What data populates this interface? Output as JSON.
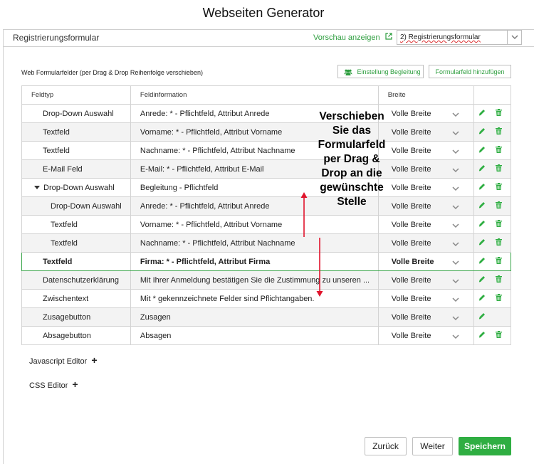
{
  "app_title": "Webseiten Generator",
  "topbar": {
    "section_label": "Registrierungsformular",
    "preview_label": "Vorschau anzeigen",
    "select_value": "2) Registrierungsformular"
  },
  "fields_label": "Web Formularfelder (per Drag & Drop Reihenfolge verschieben)",
  "buttons": {
    "accompaniment_settings": "Einstellung Begleitung",
    "add_field": "Formularfeld hinzufügen",
    "back": "Zurück",
    "next": "Weiter",
    "save": "Speichern"
  },
  "table": {
    "headers": [
      "Feldtyp",
      "Feldinformation",
      "Breite",
      ""
    ],
    "rows": [
      {
        "type": "Drop-Down Auswahl",
        "info": "Anrede: * - Pflichtfeld, Attribut Anrede",
        "width": "Volle Breite"
      },
      {
        "type": "Textfeld",
        "info": "Vorname: * - Pflichtfeld, Attribut Vorname",
        "width": "Volle Breite"
      },
      {
        "type": "Textfeld",
        "info": "Nachname: * - Pflichtfeld, Attribut Nachname",
        "width": "Volle Breite"
      },
      {
        "type": "E-Mail Feld",
        "info": "E-Mail: * - Pflichtfeld, Attribut E-Mail",
        "width": "Volle Breite"
      },
      {
        "type": "Drop-Down Auswahl",
        "info": "Begleitung - Pflichtfeld",
        "width": "Volle Breite"
      },
      {
        "type": "Drop-Down Auswahl",
        "info": "Anrede: * - Pflichtfeld, Attribut Anrede",
        "width": "Volle Breite"
      },
      {
        "type": "Textfeld",
        "info": "Vorname: * - Pflichtfeld, Attribut Vorname",
        "width": "Volle Breite"
      },
      {
        "type": "Textfeld",
        "info": "Nachname: * - Pflichtfeld, Attribut Nachname",
        "width": "Volle Breite"
      },
      {
        "type": "Textfeld",
        "info": "Firma: * - Pflichtfeld, Attribut Firma",
        "width": "Volle Breite"
      },
      {
        "type": "Datenschutzerklärung",
        "info": "Mit Ihrer Anmeldung bestätigen Sie die Zustimmung zu unseren ...",
        "width": "Volle Breite"
      },
      {
        "type": "Zwischentext",
        "info": "Mit * gekennzeichnete Felder sind Pflichtangaben.",
        "width": "Volle Breite"
      },
      {
        "type": "Zusagebutton",
        "info": "Zusagen",
        "width": "Volle Breite"
      },
      {
        "type": "Absagebutton",
        "info": "Absagen",
        "width": "Volle Breite"
      }
    ]
  },
  "overlay_text": "Verschieben Sie das Formularfeld per Drag & Drop an die gewünschte Stelle",
  "editors": {
    "javascript": "Javascript Editor",
    "css": "CSS Editor"
  },
  "colors": {
    "accent_green": "#2fae42",
    "link_green": "#2e9e3f",
    "arrow_red": "#e0142c"
  },
  "icons": {
    "edit": "pencil-icon",
    "delete": "trash-icon",
    "external": "external-link-icon",
    "group": "users-icon",
    "dropdown": "chevron-down-icon"
  }
}
